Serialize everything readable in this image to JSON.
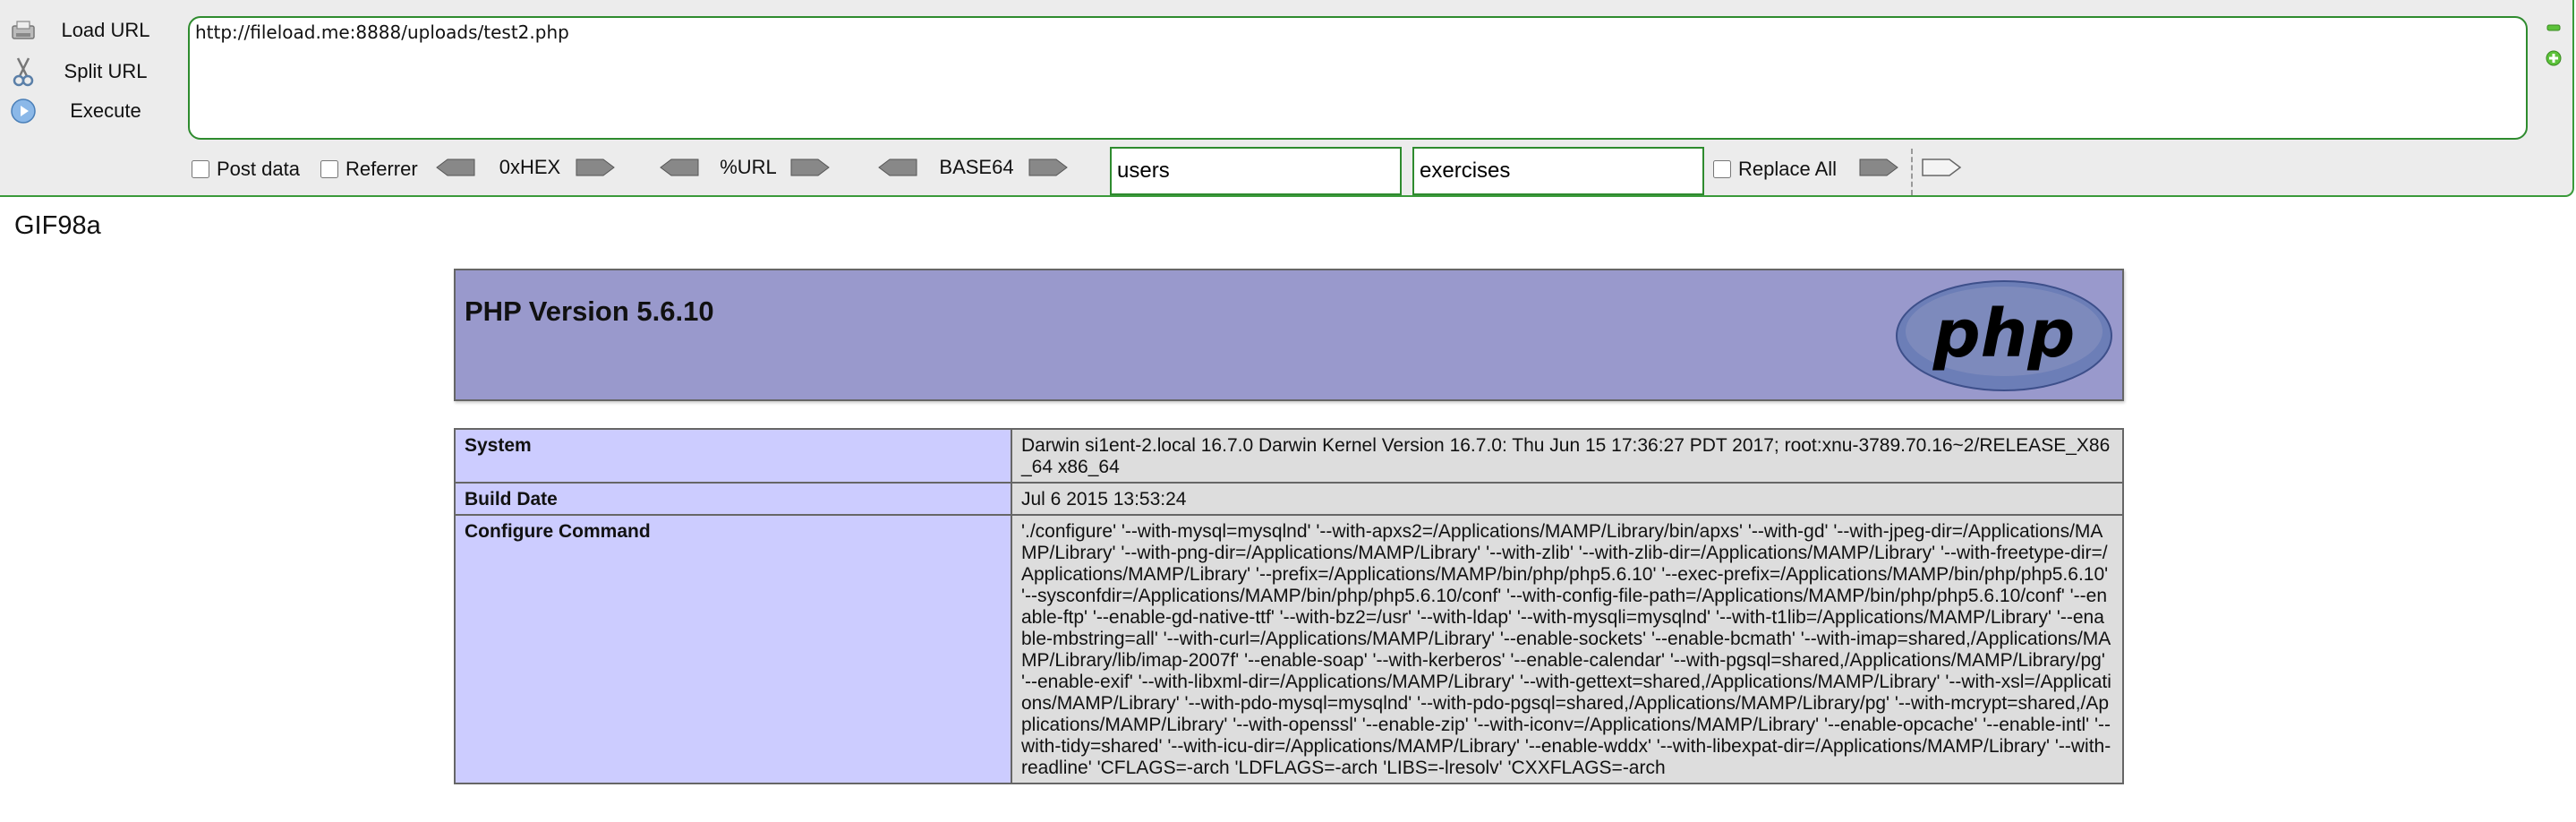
{
  "hackbar": {
    "load_url": "Load URL",
    "split_url": "Split URL",
    "execute": "Execute",
    "url_value": "http://fileload.me:8888/uploads/test2.php",
    "post_data": "Post data",
    "referrer": "Referrer",
    "hex": "0xHEX",
    "url_enc": "%URL",
    "base64": "BASE64",
    "find_value": "users",
    "replace_value": "exercises",
    "replace_all": "Replace All",
    "accent_color": "#2e8b2e"
  },
  "page": {
    "gif_header": "GIF98a",
    "php_version_title": "PHP Version 5.6.10",
    "logo_text": "php",
    "rows": [
      {
        "key": "System",
        "value": "Darwin si1ent-2.local 16.7.0 Darwin Kernel Version 16.7.0: Thu Jun 15 17:36:27 PDT 2017; root:xnu-3789.70.16~2/RELEASE_X86_64 x86_64"
      },
      {
        "key": "Build Date",
        "value": "Jul 6 2015 13:53:24"
      },
      {
        "key": "Configure Command",
        "value": "'./configure' '--with-mysql=mysqlnd' '--with-apxs2=/Applications/MAMP/Library/bin/apxs' '--with-gd' '--with-jpeg-dir=/Applications/MAMP/Library' '--with-png-dir=/Applications/MAMP/Library' '--with-zlib' '--with-zlib-dir=/Applications/MAMP/Library' '--with-freetype-dir=/Applications/MAMP/Library' '--prefix=/Applications/MAMP/bin/php/php5.6.10' '--exec-prefix=/Applications/MAMP/bin/php/php5.6.10' '--sysconfdir=/Applications/MAMP/bin/php/php5.6.10/conf' '--with-config-file-path=/Applications/MAMP/bin/php/php5.6.10/conf' '--enable-ftp' '--enable-gd-native-ttf' '--with-bz2=/usr' '--with-ldap' '--with-mysqli=mysqlnd' '--with-t1lib=/Applications/MAMP/Library' '--enable-mbstring=all' '--with-curl=/Applications/MAMP/Library' '--enable-sockets' '--enable-bcmath' '--with-imap=shared,/Applications/MAMP/Library/lib/imap-2007f' '--enable-soap' '--with-kerberos' '--enable-calendar' '--with-pgsql=shared,/Applications/MAMP/Library/pg' '--enable-exif' '--with-libxml-dir=/Applications/MAMP/Library' '--with-gettext=shared,/Applications/MAMP/Library' '--with-xsl=/Applications/MAMP/Library' '--with-pdo-mysql=mysqlnd' '--with-pdo-pgsql=shared,/Applications/MAMP/Library/pg' '--with-mcrypt=shared,/Applications/MAMP/Library' '--with-openssl' '--enable-zip' '--with-iconv=/Applications/MAMP/Library' '--enable-opcache' '--enable-intl' '--with-tidy=shared' '--with-icu-dir=/Applications/MAMP/Library' '--enable-wddx' '--with-libexpat-dir=/Applications/MAMP/Library' '--with-readline' 'CFLAGS=-arch 'LDFLAGS=-arch 'LIBS=-lresolv' 'CXXFLAGS=-arch"
      }
    ],
    "header_bg": "#9999cc",
    "key_bg": "#ccccff",
    "value_bg": "#dddddd"
  }
}
